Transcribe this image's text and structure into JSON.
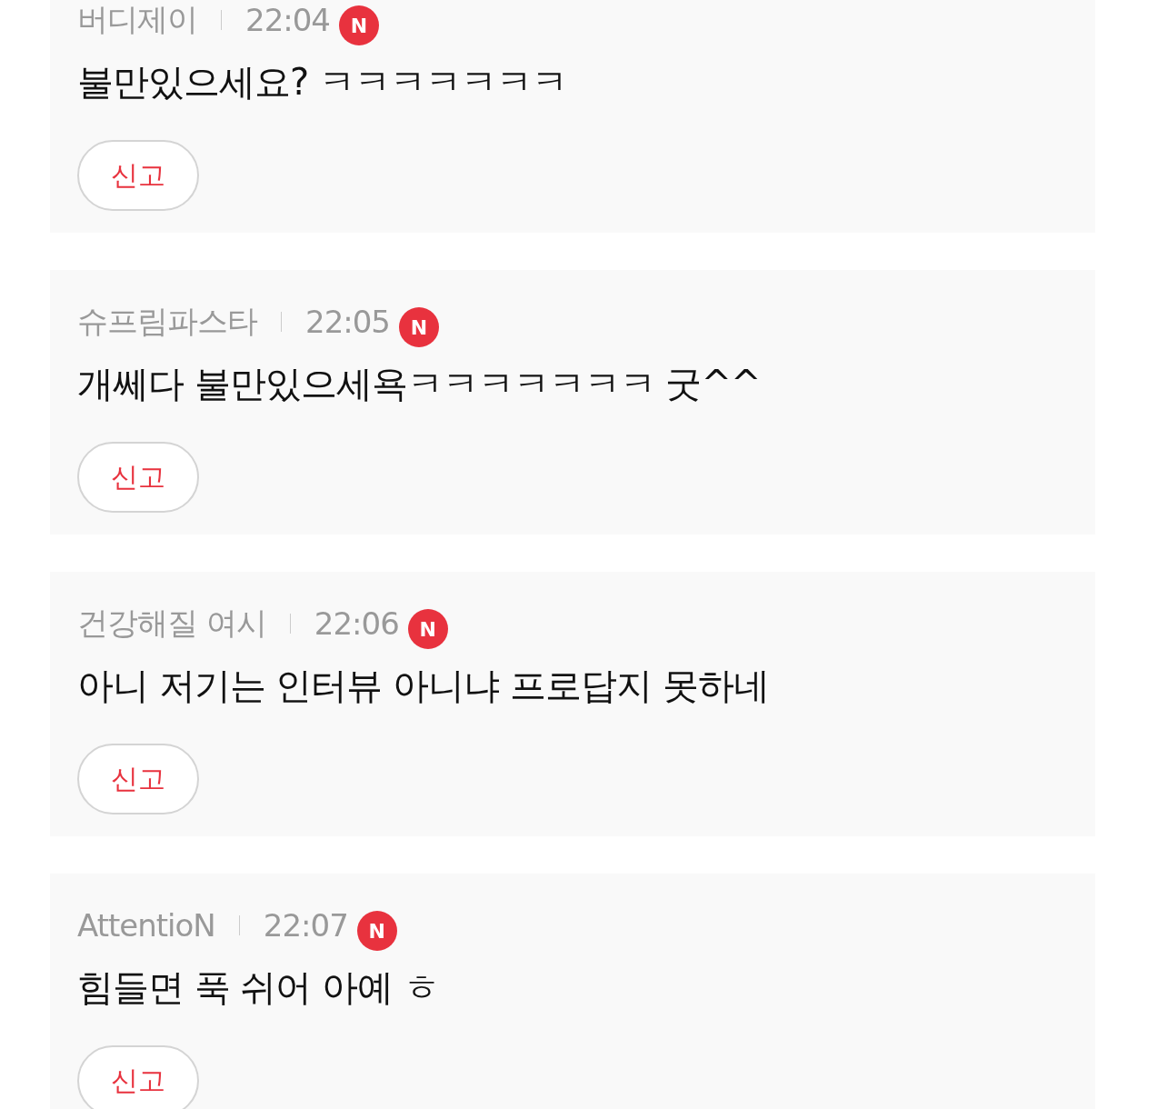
{
  "comments": [
    {
      "author": "버디제이",
      "time": "22:04",
      "badge": "N",
      "text": "불만있으세요? ㅋㅋㅋㅋㅋㅋㅋ",
      "report_button": "신고"
    },
    {
      "author": "슈프림파스타",
      "time": "22:05",
      "badge": "N",
      "text": "개쎄다 불만있으세욕ㅋㅋㅋㅋㅋㅋㅋ 굿^^",
      "report_button": "신고"
    },
    {
      "author": "건강해질 여시",
      "time": "22:06",
      "badge": "N",
      "text": "아니 저기는 인터뷰 아니냐 프로답지 못하네",
      "report_button": "신고"
    },
    {
      "author": "AttentioN",
      "time": "22:07",
      "badge": "N",
      "text": "힘들면 푹 쉬어 아예 ㅎ",
      "report_button": "신고"
    }
  ]
}
